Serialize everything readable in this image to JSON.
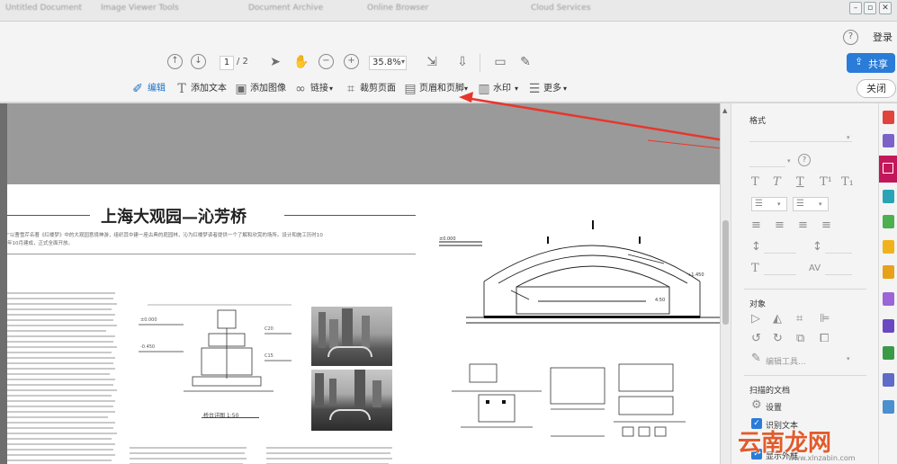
{
  "titlebar": {
    "tabs": [
      "Untitled Document",
      "Image Viewer Tools",
      "Document Archive",
      "Online Browser",
      "Cloud Services"
    ]
  },
  "menurow": {
    "help_icon": "?",
    "login": "登录"
  },
  "toolbar1": {
    "page_current": "1",
    "page_total": "/ 2",
    "zoom": "35.8%",
    "share_label": "共享"
  },
  "toolbar2": {
    "edit": "编辑",
    "add_text": "添加文本",
    "add_image": "添加图像",
    "link": "链接",
    "crop": "裁剪页面",
    "header_footer": "页眉和页脚",
    "watermark": "水印",
    "more": "更多",
    "close": "关闭"
  },
  "document": {
    "title": "上海大观园—沁芳桥",
    "intro_line1": "“以曹雪芹名著《红楼梦》中的大观园意境神游，组织其中建一座古典的庭园林，沁为红楼梦读者提供一个了解和欣赏的场所。设计和施工历时10",
    "intro_line2": "年10月建成，正式全面开放。",
    "drawing_caption": "桥台详图 1:50"
  },
  "panel": {
    "format_heading": "格式",
    "objects_heading": "对象",
    "edit_tool_label": "编辑工具...",
    "scanned_heading": "扫描的文档",
    "settings_label": "设置",
    "recognize_label": "识别文本",
    "show_outline_label": "显示外框"
  },
  "watermark": {
    "brand": "云南龙网",
    "url": "www.xlnzabin.com"
  },
  "colors": {
    "share_blue": "#2b7bd8",
    "annotation_red": "#e8362c",
    "edit_icon_blue": "#1a73c8"
  }
}
